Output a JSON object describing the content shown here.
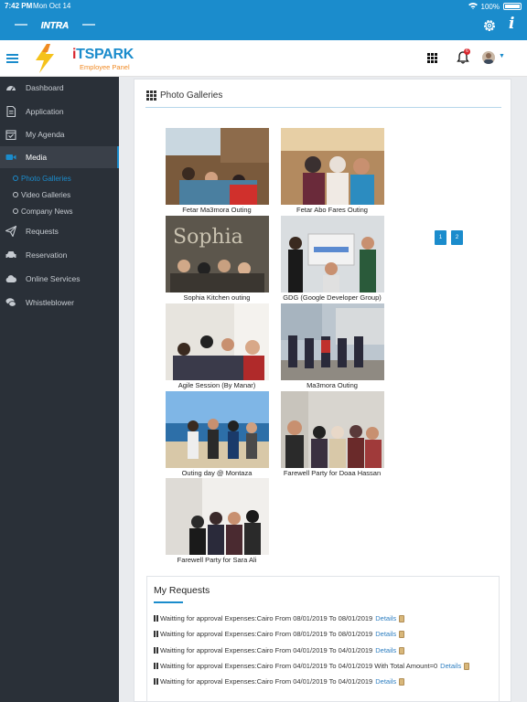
{
  "status_bar": {
    "time": "7:42 PM",
    "date": "Mon Oct 14",
    "battery": "100%"
  },
  "app_bar": {
    "logo_text": "INTRA"
  },
  "header": {
    "brand_i": "i",
    "brand_rest": "TSPARK",
    "brand_sub": "Employee Panel",
    "notification_count": "6"
  },
  "sidebar": {
    "items": [
      {
        "label": "Dashboard",
        "icon": "dashboard-icon"
      },
      {
        "label": "Application",
        "icon": "file-icon"
      },
      {
        "label": "My Agenda",
        "icon": "calendar-check-icon"
      },
      {
        "label": "Media",
        "icon": "video-camera-icon"
      },
      {
        "label": "Requests",
        "icon": "paper-plane-icon"
      },
      {
        "label": "Reservation",
        "icon": "car-icon"
      },
      {
        "label": "Online Services",
        "icon": "cloud-icon"
      },
      {
        "label": "Whistleblower",
        "icon": "comments-icon"
      }
    ],
    "media_sub": [
      "Photo Galleries",
      "Video Galleries",
      "Company News"
    ]
  },
  "gallery": {
    "title": "Photo Galleries",
    "items": [
      "Fetar Ma3mora Outing",
      "Fetar Abo Fares Outing",
      "Sophia Kitchen outing",
      "GDG (Google Developer Group)",
      "Agile Session (By Manar)",
      "Ma3mora Outing",
      "Outing day @ Montaza",
      "Farewell Party for Doaa Hassan",
      "Farewell Party for Sara Ali"
    ],
    "pages": [
      "1",
      "2"
    ]
  },
  "requests": {
    "title": "My Requests",
    "details_label": "Details",
    "rows": [
      "Waitting for approval Expenses:Cairo From 08/01/2019 To 08/01/2019",
      "Waitting for approval Expenses:Cairo From 08/01/2019 To 08/01/2019",
      "Waitting for approval Expenses:Cairo From 04/01/2019 To 04/01/2019",
      "Waitting for approval Expenses:Cairo From 04/01/2019 To 04/01/2019 With Total Amount=0",
      "Waitting for approval Expenses:Cairo From 04/01/2019 To 04/01/2019"
    ]
  },
  "colors": {
    "brand_blue": "#1b8ccc",
    "brand_red": "#d9272e",
    "brand_orange": "#f08a24",
    "sidebar": "#2a3038"
  }
}
